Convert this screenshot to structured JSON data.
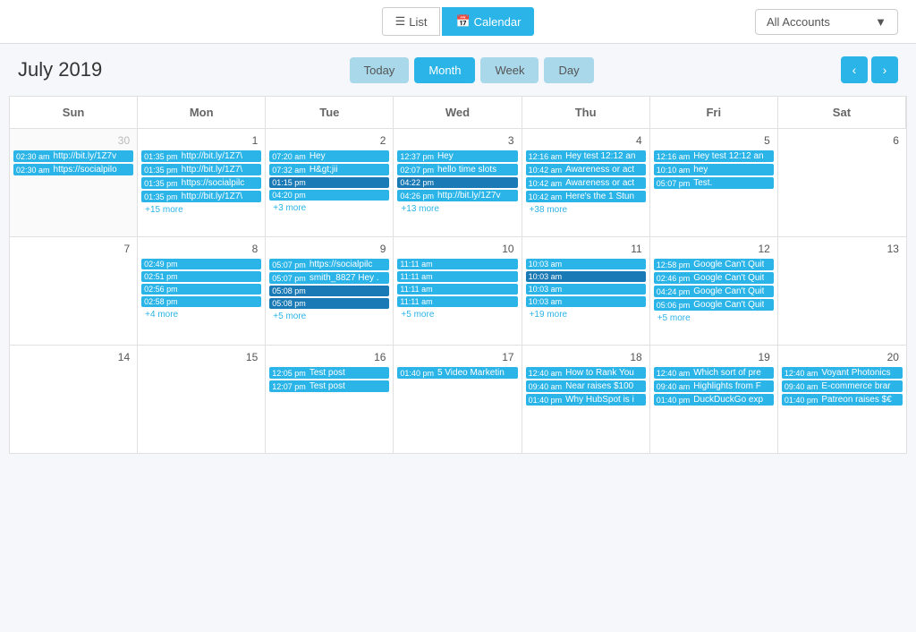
{
  "topbar": {
    "list_label": "List",
    "calendar_label": "Calendar",
    "account_label": "All Accounts"
  },
  "header": {
    "title": "July 2019",
    "today_label": "Today",
    "month_label": "Month",
    "week_label": "Week",
    "day_label": "Day"
  },
  "day_headers": [
    "Sun",
    "Mon",
    "Tue",
    "Wed",
    "Thu",
    "Fri",
    "Sat"
  ],
  "weeks": [
    {
      "days": [
        {
          "num": "30",
          "other": true,
          "events": [
            {
              "type": "blue",
              "time": "02:30 am",
              "text": "http://bit.ly/1Z7v"
            },
            {
              "type": "blue",
              "time": "02:30 am",
              "text": "https://socialpilo"
            }
          ]
        },
        {
          "num": "1",
          "events": [
            {
              "type": "blue",
              "time": "01:35 pm",
              "text": "http://bit.ly/1Z7\\"
            },
            {
              "type": "blue",
              "time": "01:35 pm",
              "text": "http://bit.ly/1Z7\\"
            },
            {
              "type": "blue",
              "time": "01:35 pm",
              "text": "https://socialpilc"
            },
            {
              "type": "blue",
              "time": "01:35 pm",
              "text": "http://bit.ly/1Z7\\"
            }
          ],
          "more": "+15 more"
        },
        {
          "num": "2",
          "events": [
            {
              "type": "blue",
              "time": "07:20 am",
              "text": "Hey"
            },
            {
              "type": "blue",
              "time": "07:32 am",
              "text": "H&gt;jii"
            },
            {
              "type": "dark-blue",
              "time": "01:15 pm",
              "text": ""
            },
            {
              "type": "blue",
              "time": "04:20 pm",
              "text": ""
            }
          ],
          "more": "+3 more"
        },
        {
          "num": "3",
          "events": [
            {
              "type": "blue",
              "time": "12:37 pm",
              "text": "Hey"
            },
            {
              "type": "blue",
              "time": "02:07 pm",
              "text": "hello time slots"
            },
            {
              "type": "dark-blue",
              "time": "04:22 pm",
              "text": ""
            },
            {
              "type": "blue",
              "time": "04:26 pm",
              "text": "http://bit.ly/1Z7v"
            }
          ],
          "more": "+13 more"
        },
        {
          "num": "4",
          "events": [
            {
              "type": "blue",
              "time": "12:16 am",
              "text": "Hey test 12:12 an"
            },
            {
              "type": "blue",
              "time": "10:42 am",
              "text": "Awareness or act"
            },
            {
              "type": "blue",
              "time": "10:42 am",
              "text": "Awareness or act"
            },
            {
              "type": "blue",
              "time": "10:42 am",
              "text": "Here's the 1 Stun"
            }
          ],
          "more": "+38 more"
        },
        {
          "num": "5",
          "events": [
            {
              "type": "blue",
              "time": "12:16 am",
              "text": "Hey test 12:12 an"
            },
            {
              "type": "blue",
              "time": "10:10 am",
              "text": "hey"
            },
            {
              "type": "blue",
              "time": "05:07 pm",
              "text": "Test."
            }
          ]
        },
        {
          "num": "6",
          "events": []
        }
      ]
    },
    {
      "days": [
        {
          "num": "7",
          "events": []
        },
        {
          "num": "8",
          "events": [
            {
              "type": "blue",
              "time": "02:49 pm",
              "text": ""
            },
            {
              "type": "blue",
              "time": "02:51 pm",
              "text": ""
            },
            {
              "type": "blue",
              "time": "02:56 pm",
              "text": ""
            },
            {
              "type": "blue",
              "time": "02:58 pm",
              "text": ""
            }
          ],
          "more": "+4 more"
        },
        {
          "num": "9",
          "events": [
            {
              "type": "blue",
              "time": "05:07 pm",
              "text": "https://socialpilc"
            },
            {
              "type": "blue",
              "time": "05:07 pm",
              "text": "smith_8827 Hey ."
            },
            {
              "type": "dark-blue",
              "time": "05:08 pm",
              "text": ""
            },
            {
              "type": "dark-blue",
              "time": "05:08 pm",
              "text": ""
            }
          ],
          "more": "+5 more"
        },
        {
          "num": "10",
          "events": [
            {
              "type": "blue",
              "time": "11:11 am",
              "text": ""
            },
            {
              "type": "blue",
              "time": "11:11 am",
              "text": ""
            },
            {
              "type": "blue",
              "time": "11:11 am",
              "text": ""
            },
            {
              "type": "blue",
              "time": "11:11 am",
              "text": ""
            }
          ],
          "more": "+5 more"
        },
        {
          "num": "11",
          "events": [
            {
              "type": "blue",
              "time": "10:03 am",
              "text": ""
            },
            {
              "type": "dark-blue",
              "time": "10:03 am",
              "text": ""
            },
            {
              "type": "blue",
              "time": "10:03 am",
              "text": ""
            },
            {
              "type": "blue",
              "time": "10:03 am",
              "text": ""
            }
          ],
          "more": "+19 more"
        },
        {
          "num": "12",
          "events": [
            {
              "type": "blue",
              "time": "12:58 pm",
              "text": "Google Can't Quit"
            },
            {
              "type": "blue",
              "time": "02:46 pm",
              "text": "Google Can't Quit"
            },
            {
              "type": "blue",
              "time": "04:24 pm",
              "text": "Google Can't Quit"
            },
            {
              "type": "blue",
              "time": "05:06 pm",
              "text": "Google Can't Quit"
            }
          ],
          "more": "+5 more"
        },
        {
          "num": "13",
          "events": []
        }
      ]
    },
    {
      "days": [
        {
          "num": "14",
          "events": []
        },
        {
          "num": "15",
          "events": []
        },
        {
          "num": "16",
          "events": [
            {
              "type": "blue",
              "time": "12:05 pm",
              "text": "Test post"
            },
            {
              "type": "blue",
              "time": "12:07 pm",
              "text": "Test post"
            }
          ]
        },
        {
          "num": "17",
          "events": [
            {
              "type": "blue",
              "time": "01:40 pm",
              "text": "5 Video Marketin"
            }
          ]
        },
        {
          "num": "18",
          "events": [
            {
              "type": "blue",
              "time": "12:40 am",
              "text": "How to Rank You"
            },
            {
              "type": "blue",
              "time": "09:40 am",
              "text": "Near raises $100"
            },
            {
              "type": "blue",
              "time": "01:40 pm",
              "text": "Why HubSpot is i"
            }
          ]
        },
        {
          "num": "19",
          "events": [
            {
              "type": "blue",
              "time": "12:40 am",
              "text": "Which sort of pre"
            },
            {
              "type": "blue",
              "time": "09:40 am",
              "text": "Highlights from F"
            },
            {
              "type": "blue",
              "time": "01:40 pm",
              "text": "DuckDuckGo exp"
            }
          ]
        },
        {
          "num": "20",
          "events": [
            {
              "type": "blue",
              "time": "12:40 am",
              "text": "Voyant Photonics"
            },
            {
              "type": "blue",
              "time": "09:40 am",
              "text": "E-commerce brar"
            },
            {
              "type": "blue",
              "time": "01:40 pm",
              "text": "Patreon raises $€"
            }
          ]
        }
      ]
    }
  ]
}
